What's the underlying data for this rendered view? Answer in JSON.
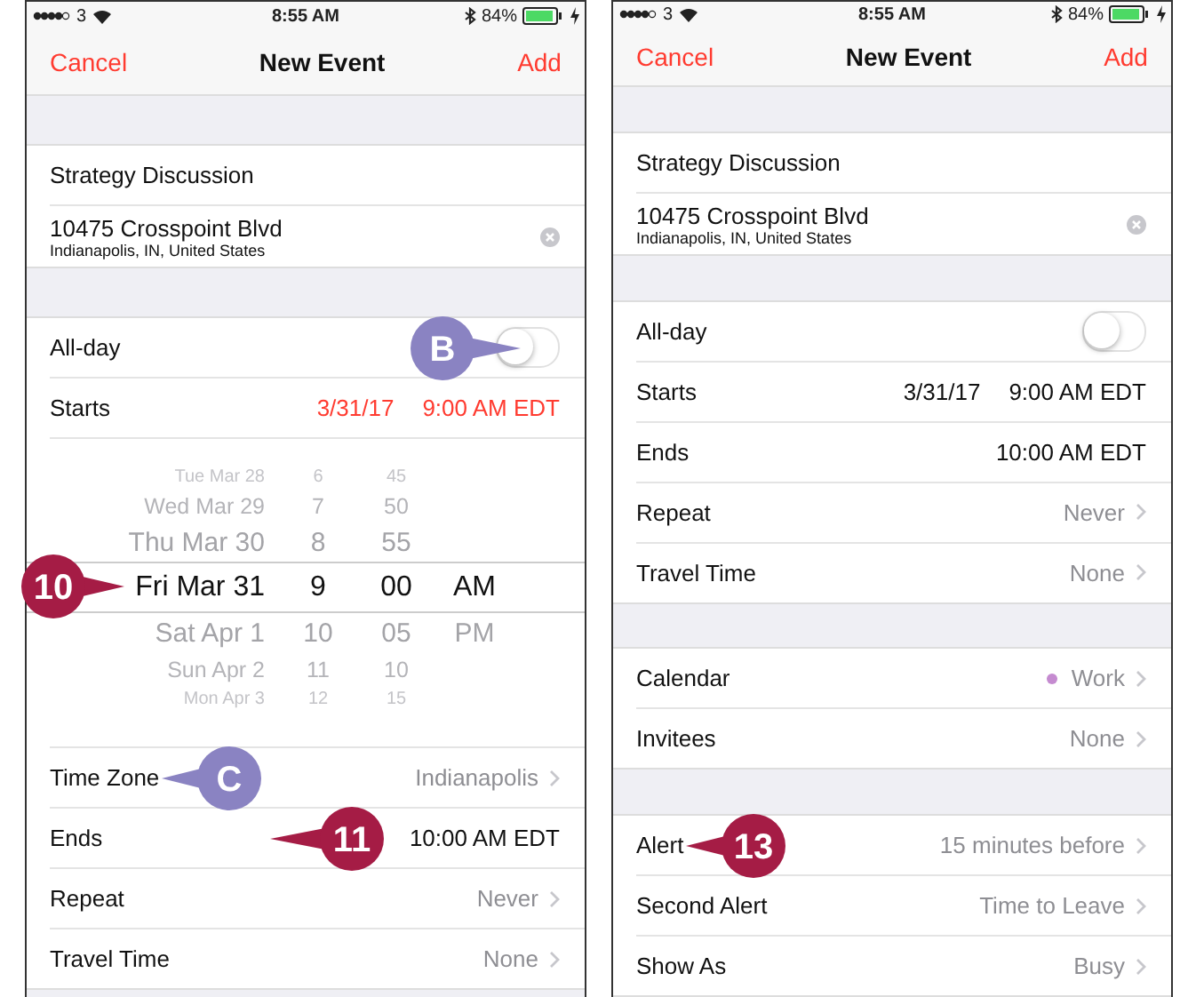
{
  "phones": [
    {
      "status_bar": {
        "carrier": "3",
        "time": "8:55 AM",
        "battery": "84%"
      },
      "nav": {
        "cancel": "Cancel",
        "title": "New Event",
        "add": "Add"
      },
      "sections": [
        {
          "rows": [
            {
              "kind": "text",
              "label": "Strategy Discussion"
            },
            {
              "kind": "location",
              "label": "10475 Crosspoint Blvd",
              "detail": "Indianapolis, IN, United States"
            }
          ]
        },
        {
          "rows": [
            {
              "kind": "toggle",
              "label": "All-day",
              "on": false,
              "callout": {
                "label": "B",
                "color": "#8a83c2"
              }
            },
            {
              "kind": "datetime",
              "label": "Starts",
              "date": "3/31/17",
              "time": "9:00 AM EDT",
              "active": true
            },
            {
              "kind": "picker",
              "callout": {
                "label": "10",
                "color": "#a51c45"
              },
              "rows": [
                {
                  "cells": [
                    "Tue Mar 28",
                    "6",
                    "45"
                  ],
                  "selected": false
                },
                {
                  "cells": [
                    "Wed Mar 29",
                    "7",
                    "50"
                  ],
                  "selected": false
                },
                {
                  "cells": [
                    "Thu Mar 30",
                    "8",
                    "55"
                  ],
                  "selected": false
                },
                {
                  "cells": [
                    "Fri Mar 31",
                    "9",
                    "00",
                    "AM"
                  ],
                  "selected": true
                },
                {
                  "cells": [
                    "Sat Apr 1",
                    "10",
                    "05",
                    "PM"
                  ],
                  "selected": false
                },
                {
                  "cells": [
                    "Sun Apr 2",
                    "11",
                    "10"
                  ],
                  "selected": false
                },
                {
                  "cells": [
                    "Mon Apr 3",
                    "12",
                    "15"
                  ],
                  "selected": false
                }
              ]
            },
            {
              "kind": "value",
              "label": "Time Zone",
              "value": "Indianapolis",
              "chevron": true,
              "callout": {
                "label": "C",
                "color": "#8a83c2"
              }
            },
            {
              "kind": "value",
              "label": "Ends",
              "value": "10:00 AM EDT",
              "chevron": false,
              "callout": {
                "label": "11",
                "color": "#a51c45"
              }
            },
            {
              "kind": "value",
              "label": "Repeat",
              "value": "Never",
              "chevron": true
            },
            {
              "kind": "value",
              "label": "Travel Time",
              "value": "None",
              "chevron": true
            }
          ]
        }
      ]
    },
    {
      "status_bar": {
        "carrier": "3",
        "time": "8:55 AM",
        "battery": "84%"
      },
      "nav": {
        "cancel": "Cancel",
        "title": "New Event",
        "add": "Add"
      },
      "sections": [
        {
          "rows": [
            {
              "kind": "text",
              "label": "Strategy Discussion"
            },
            {
              "kind": "location",
              "label": "10475 Crosspoint Blvd",
              "detail": "Indianapolis, IN, United States"
            }
          ]
        },
        {
          "rows": [
            {
              "kind": "toggle",
              "label": "All-day",
              "on": false
            },
            {
              "kind": "datetime",
              "label": "Starts",
              "date": "3/31/17",
              "time": "9:00 AM EDT",
              "active": false
            },
            {
              "kind": "value",
              "label": "Ends",
              "value": "10:00 AM EDT",
              "chevron": false
            },
            {
              "kind": "value",
              "label": "Repeat",
              "value": "Never",
              "chevron": true
            },
            {
              "kind": "value",
              "label": "Travel Time",
              "value": "None",
              "chevron": true
            }
          ]
        },
        {
          "rows": [
            {
              "kind": "value",
              "label": "Calendar",
              "value": "Work",
              "chevron": true,
              "color": "#c58bd0"
            },
            {
              "kind": "value",
              "label": "Invitees",
              "value": "None",
              "chevron": true
            }
          ]
        },
        {
          "rows": [
            {
              "kind": "value",
              "label": "Alert",
              "value": "15 minutes before",
              "chevron": true,
              "callout": {
                "label": "13",
                "color": "#a51c45"
              }
            },
            {
              "kind": "value",
              "label": "Second Alert",
              "value": "Time to Leave",
              "chevron": true
            },
            {
              "kind": "value",
              "label": "Show As",
              "value": "Busy",
              "chevron": true
            }
          ]
        }
      ]
    }
  ]
}
